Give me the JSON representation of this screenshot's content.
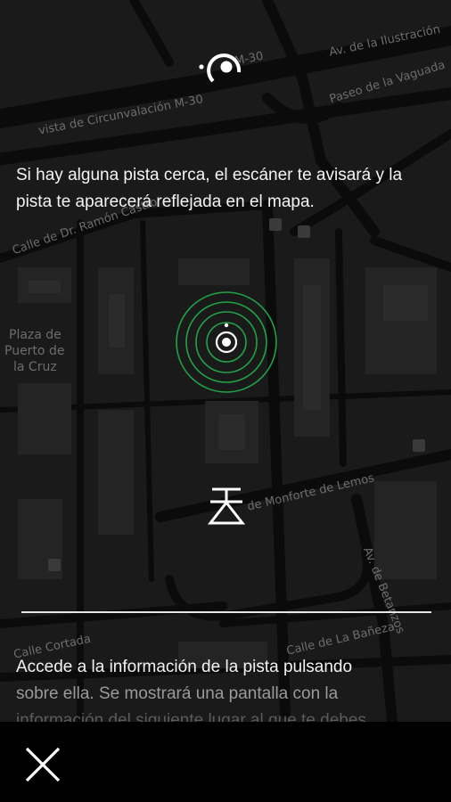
{
  "map": {
    "labels": {
      "circunvalacion": "vista de Circunvalación M-30",
      "m30": "M-30",
      "ilustracion": "Av. de la Ilustración",
      "vaguada": "Paseo de la Vaguada",
      "ramon_castroviejo": "Calle de Dr. Ramón Castro",
      "plaza_line1": "Plaza de",
      "plaza_line2": "Puerto de",
      "plaza_line3": "la Cruz",
      "monforte": "de Monforte de Lemos",
      "betanzos": "Av. de Betanzos",
      "cortada": "Calle Cortada",
      "baneza": "Calle de La Bañeza"
    }
  },
  "tutorial": {
    "intro_text": "Si hay alguna pista cerca, el escáner te avisará y la pista te aparecerá reflejada en el mapa.",
    "info_line1": "Accede a la información de la pista pulsando",
    "info_line2": "sobre ella. Se mostrará una pantalla con la",
    "info_line3": "información del siguiente lugar al que te debes"
  },
  "colors": {
    "scanner_ring": "#1fa347",
    "background": "#1a1a1a",
    "bottom_bar": "#000000"
  },
  "icons": {
    "logo": "scanner-logo-icon",
    "scanner": "radar-scanner-icon",
    "marker": "clue-marker-icon",
    "close": "close-icon"
  }
}
